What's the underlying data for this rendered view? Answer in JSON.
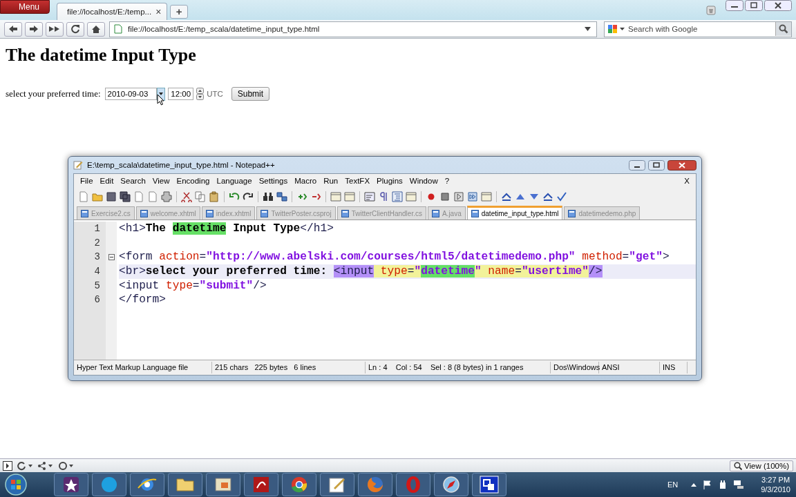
{
  "browser": {
    "menu": "Menu",
    "tab": {
      "title": "file://localhost/E:/temp...",
      "close": "×"
    },
    "new_tab": "+",
    "address": "file://localhost/E:/temp_scala/datetime_input_type.html",
    "search": {
      "placeholder": "Search with Google"
    }
  },
  "page": {
    "heading": "The datetime Input Type",
    "label": "select your preferred time:",
    "date": "2010-09-03",
    "time": "12:00",
    "zone": "UTC",
    "submit": "Submit"
  },
  "notepad": {
    "title": "E:\\temp_scala\\datetime_input_type.html - Notepad++",
    "menu": [
      "File",
      "Edit",
      "Search",
      "View",
      "Encoding",
      "Language",
      "Settings",
      "Macro",
      "Run",
      "TextFX",
      "Plugins",
      "Window",
      "?"
    ],
    "close_doc": "X",
    "tabs": [
      {
        "label": "Exercise2.cs",
        "selected": false
      },
      {
        "label": "welcome.xhtml",
        "selected": false
      },
      {
        "label": "index.xhtml",
        "selected": false
      },
      {
        "label": "TwitterPoster.csproj",
        "selected": false
      },
      {
        "label": "TwitterClientHandler.cs",
        "selected": false
      },
      {
        "label": "A.java",
        "selected": false
      },
      {
        "label": "datetime_input_type.html",
        "selected": true
      },
      {
        "label": "datetimedemo.php",
        "selected": false
      }
    ],
    "lines": [
      {
        "number": "1",
        "current": false,
        "fold": false,
        "tokens": [
          {
            "t": "<h1>",
            "kind": "tag"
          },
          {
            "t": "The ",
            "kind": "text"
          },
          {
            "t": "datetime",
            "kind": "text",
            "smart_match": true
          },
          {
            "t": " Input Type",
            "kind": "text"
          },
          {
            "t": "</h1>",
            "kind": "tag"
          }
        ]
      },
      {
        "number": "2",
        "current": false,
        "fold": false
      },
      {
        "number": "3",
        "current": false,
        "fold": true,
        "tokens": [
          {
            "t": "<form ",
            "kind": "tag"
          },
          {
            "t": "action",
            "kind": "attr"
          },
          {
            "t": "=",
            "kind": "tag"
          },
          {
            "t": "\"http://www.abelski.com/courses/html5/datetimedemo.php\"",
            "kind": "str"
          },
          {
            "t": " method",
            "kind": "attr"
          },
          {
            "t": "=",
            "kind": "tag"
          },
          {
            "t": "\"get\"",
            "kind": "str"
          },
          {
            "t": ">",
            "kind": "tag"
          }
        ]
      },
      {
        "number": "4",
        "current": true,
        "fold": false,
        "tokens": [
          {
            "t": "<br>",
            "kind": "tag"
          },
          {
            "t": "select your preferred time: ",
            "kind": "text"
          },
          {
            "t": "<input",
            "kind": "tag",
            "tag_match": true
          },
          {
            "t": " type",
            "kind": "attr",
            "attr_highlight": true
          },
          {
            "t": "=",
            "kind": "tag",
            "attr_highlight": true
          },
          {
            "t": "\"",
            "kind": "str",
            "attr_highlight": true
          },
          {
            "t": "datetime",
            "kind": "str",
            "smart_match": true
          },
          {
            "t": "\"",
            "kind": "str",
            "attr_highlight": true
          },
          {
            "t": " name",
            "kind": "attr",
            "attr_highlight": true
          },
          {
            "t": "=",
            "kind": "tag",
            "attr_highlight": true
          },
          {
            "t": "\"usertime\"",
            "kind": "str",
            "attr_highlight": true
          },
          {
            "t": "/>",
            "kind": "tag",
            "tag_match": true
          }
        ]
      },
      {
        "number": "5",
        "current": false,
        "fold": false,
        "tokens": [
          {
            "t": "<input ",
            "kind": "tag"
          },
          {
            "t": "type",
            "kind": "attr"
          },
          {
            "t": "=",
            "kind": "tag"
          },
          {
            "t": "\"submit\"",
            "kind": "str"
          },
          {
            "t": "/>",
            "kind": "tag"
          }
        ]
      },
      {
        "number": "6",
        "current": false,
        "fold": false,
        "tokens": [
          {
            "t": "</form>",
            "kind": "tag"
          }
        ]
      }
    ],
    "status": [
      "Hyper Text Markup Language file",
      "215 chars   225 bytes   6 lines",
      "Ln : 4    Col : 54    Sel : 8 (8 bytes) in 1 ranges",
      "Dos\\Windows",
      "ANSI",
      "INS"
    ]
  },
  "status_bar": {
    "zoom": "View (100%)"
  },
  "taskbar": {
    "language": "EN",
    "time": "3:27 PM",
    "date": "9/3/2010"
  }
}
